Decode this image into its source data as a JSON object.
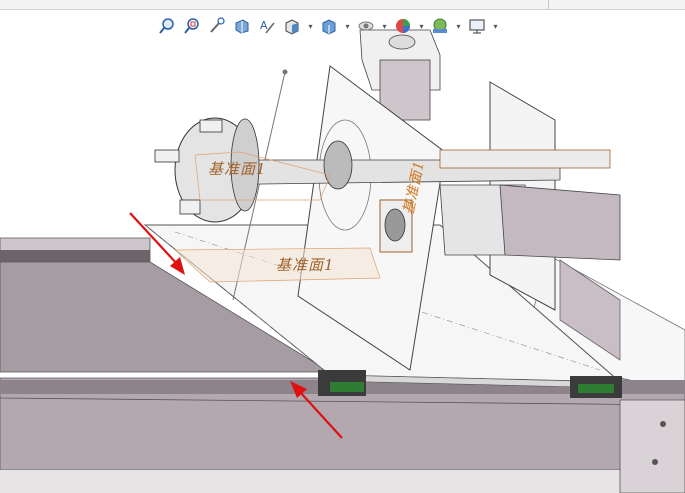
{
  "toolbar": {
    "icons": [
      "zoom-to-fit-icon",
      "zoom-to-area-icon",
      "previous-view-icon",
      "section-view-icon",
      "dynamic-annotation-icon",
      "view-orientation-icon",
      "display-style-icon",
      "hide-show-items-icon",
      "edit-appearance-icon",
      "apply-scene-icon",
      "view-settings-icon"
    ],
    "dropdown_glyph": "▾"
  },
  "scene": {
    "plane_labels": [
      "基准面1",
      "基准面1",
      "基准面1"
    ],
    "colors": {
      "annotation_arrow": "#e01010",
      "plane_label": "#a0622a",
      "rail_highlight": "#2e7d32",
      "metal": "#b9aeb6",
      "metal_dark": "#7d7079",
      "plate": "#f3f3f3"
    }
  }
}
